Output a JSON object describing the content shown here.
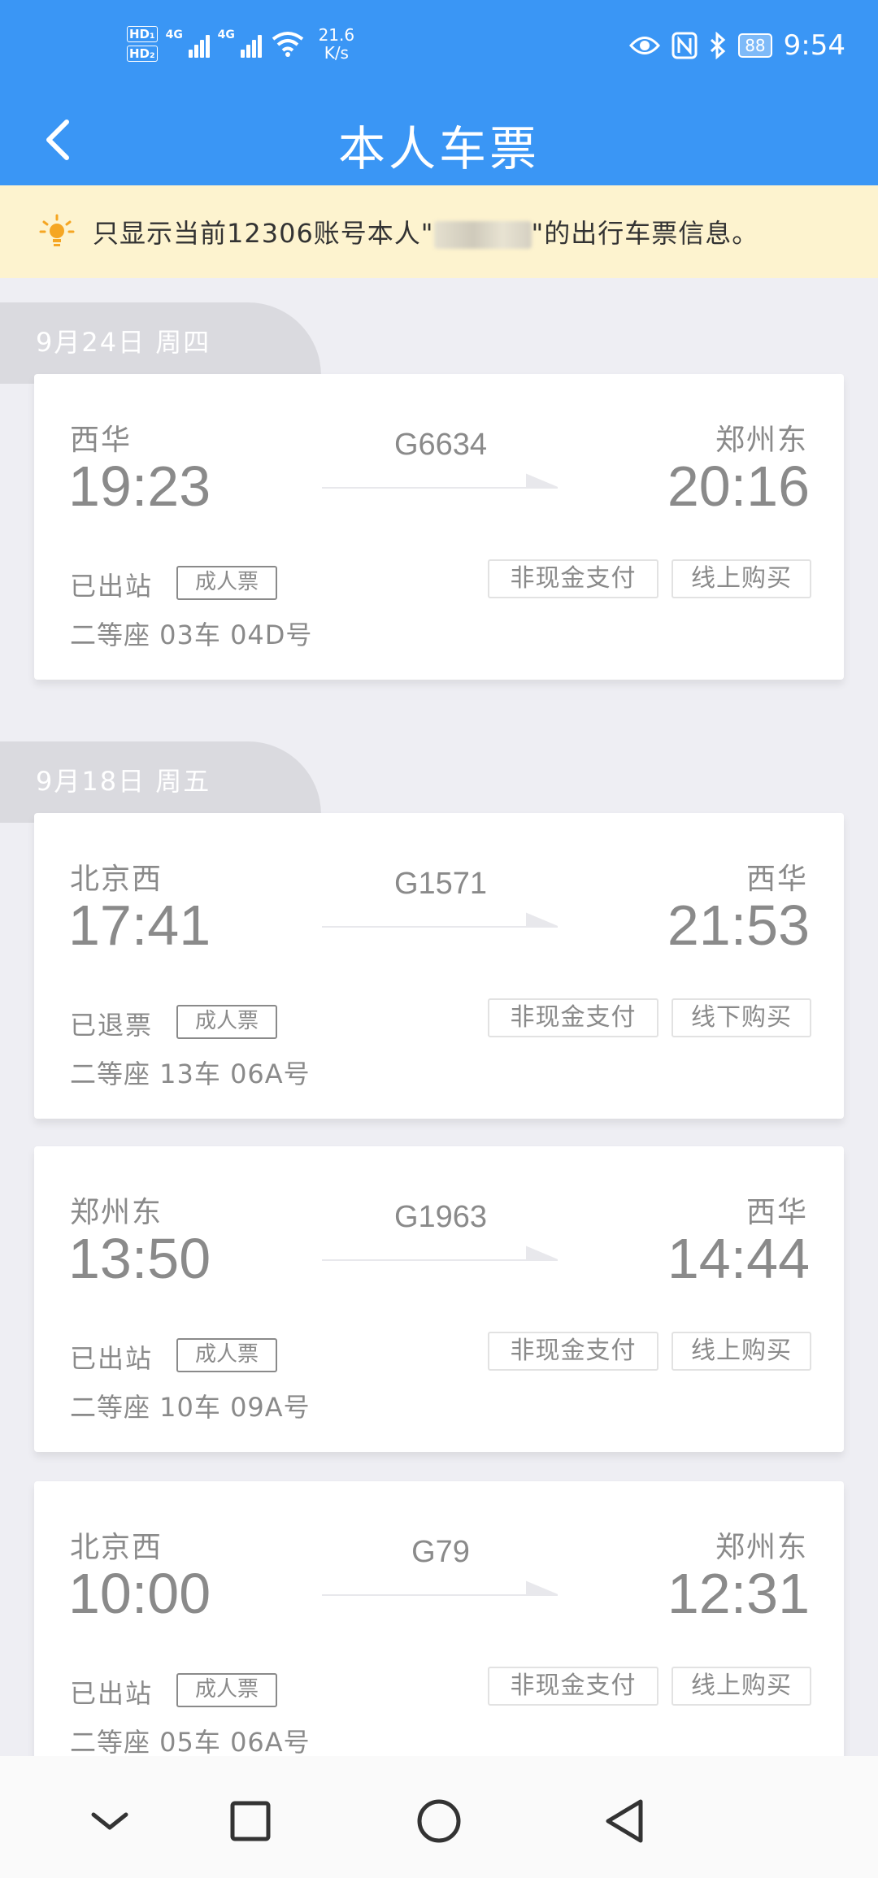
{
  "status_bar": {
    "hd1": "HD₁",
    "hd2": "HD₂",
    "net1": "4G",
    "net2": "4G",
    "speed_value": "21.6",
    "speed_unit": "K/s",
    "battery": "88",
    "time": "9:54"
  },
  "header": {
    "title": "本人车票"
  },
  "notice": {
    "text_before": "只显示当前12306账号本人\"",
    "text_after": "\"的出行车票信息。"
  },
  "groups": [
    {
      "date": "9月24日  周四",
      "tickets": [
        {
          "from": "西华",
          "to": "郑州东",
          "train": "G6634",
          "dep": "19:23",
          "arr": "20:16",
          "status": "已出站",
          "type": "成人票",
          "payment": "非现金支付",
          "purchase": "线上购买",
          "seat": "二等座 03车 04D号"
        }
      ]
    },
    {
      "date": "9月18日  周五",
      "tickets": [
        {
          "from": "北京西",
          "to": "西华",
          "train": "G1571",
          "dep": "17:41",
          "arr": "21:53",
          "status": "已退票",
          "type": "成人票",
          "payment": "非现金支付",
          "purchase": "线下购买",
          "seat": "二等座 13车 06A号"
        },
        {
          "from": "郑州东",
          "to": "西华",
          "train": "G1963",
          "dep": "13:50",
          "arr": "14:44",
          "status": "已出站",
          "type": "成人票",
          "payment": "非现金支付",
          "purchase": "线上购买",
          "seat": "二等座 10车 09A号"
        },
        {
          "from": "北京西",
          "to": "郑州东",
          "train": "G79",
          "dep": "10:00",
          "arr": "12:31",
          "status": "已出站",
          "type": "成人票",
          "payment": "非现金支付",
          "purchase": "线上购买",
          "seat": "二等座 05车 06A号"
        }
      ]
    }
  ],
  "icons": {
    "back": "chevron-left-icon",
    "notice": "lightbulb-icon",
    "nav_down": "chevron-down-icon",
    "nav_recent": "square-icon",
    "nav_home": "circle-icon",
    "nav_back": "triangle-left-icon"
  },
  "colors": {
    "header": "#3a96f5",
    "notice_bg": "#fdf3cf",
    "page_bg": "#eeeef3",
    "bulb": "#f5a623"
  }
}
